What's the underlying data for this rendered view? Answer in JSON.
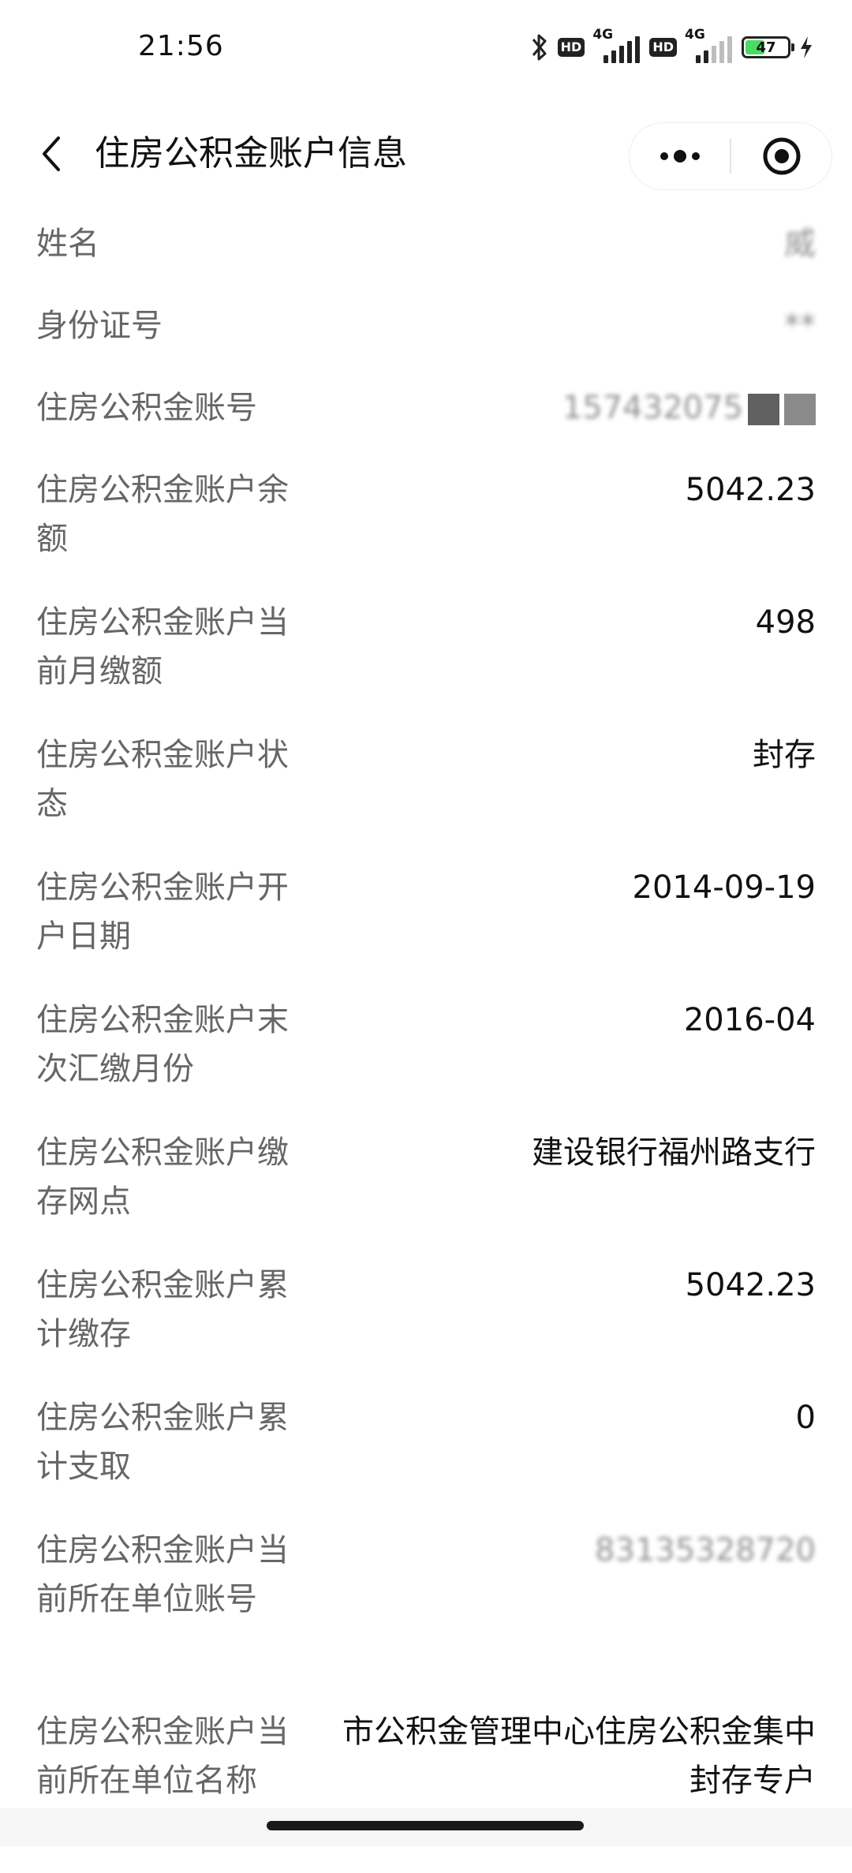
{
  "status_bar": {
    "time": "21:56",
    "network_1": "4G",
    "network_2": "4G",
    "hd_label_1": "HD",
    "hd_label_2": "HD",
    "battery_level": "47",
    "battery_fraction": 0.47,
    "battery_color": "#4cd964"
  },
  "nav": {
    "title": "住房公积金账户信息",
    "back_icon": "chevron-left-icon",
    "more_icon": "more-dots-icon",
    "close_icon": "target-close-icon"
  },
  "fields": [
    {
      "label": "姓名",
      "value": "威"
    },
    {
      "label": "身份证号",
      "value": "**"
    },
    {
      "label": "住房公积金账号",
      "value": "157432075"
    },
    {
      "label": "住房公积金账户余额",
      "value": "5042.23"
    },
    {
      "label": "住房公积金账户当前月缴额",
      "value": "498"
    },
    {
      "label": "住房公积金账户状态",
      "value": "封存"
    },
    {
      "label": "住房公积金账户开户日期",
      "value": "2014-09-19"
    },
    {
      "label": "住房公积金账户末次汇缴月份",
      "value": "2016-04"
    },
    {
      "label": "住房公积金账户缴存网点",
      "value": "建设银行福州路支行"
    },
    {
      "label": "住房公积金账户累计缴存",
      "value": "5042.23"
    },
    {
      "label": "住房公积金账户累计支取",
      "value": "0"
    },
    {
      "label": "住房公积金账户当前所在单位账号",
      "value": "83135328720"
    },
    {
      "label": "住房公积金账户当前所在单位名称",
      "value": "市公积金管理中心住房公积金集中封存专户"
    }
  ]
}
